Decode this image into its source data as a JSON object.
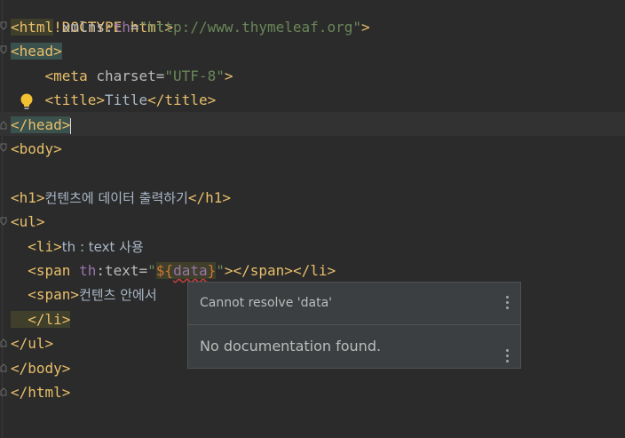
{
  "editor": {
    "lines": [
      {
        "parts": [
          "<!DOCTYPE html>"
        ]
      },
      {
        "parts": [
          "<html",
          " xmlns:",
          "th",
          "=",
          "\"http://www.thymeleaf.org\"",
          ">"
        ]
      },
      {
        "parts": [
          "<head>"
        ]
      },
      {
        "parts": [
          "    <meta",
          " charset",
          "=",
          "\"UTF-8\"",
          ">"
        ]
      },
      {
        "parts": [
          "    <title>",
          "Title",
          "</title>"
        ]
      },
      {
        "parts": [
          "</head>"
        ]
      },
      {
        "parts": [
          "<body>"
        ]
      },
      {
        "parts": [
          ""
        ]
      },
      {
        "parts": [
          "<h1>",
          "컨텐츠에 데이터 출력하기",
          "</h1>"
        ]
      },
      {
        "parts": [
          "<ul>"
        ]
      },
      {
        "parts": [
          "  <li>",
          "th : text 사용"
        ]
      },
      {
        "parts": [
          "  <span",
          " th",
          ":text",
          "=",
          "\"",
          "${",
          "data",
          "}",
          "\"",
          "></span></li>"
        ]
      },
      {
        "parts": [
          "  <span>",
          "컨텐츠 안에서 "
        ]
      },
      {
        "parts": [
          "  </li>"
        ]
      },
      {
        "parts": [
          "</ul>"
        ]
      },
      {
        "parts": [
          "</body>"
        ]
      },
      {
        "parts": [
          "</html>"
        ]
      }
    ]
  },
  "popup": {
    "message": "Cannot resolve 'data'",
    "doc": "No documentation found."
  },
  "icons": {
    "bulb": "lightbulb-icon",
    "menu": "more-vertical-icon"
  }
}
